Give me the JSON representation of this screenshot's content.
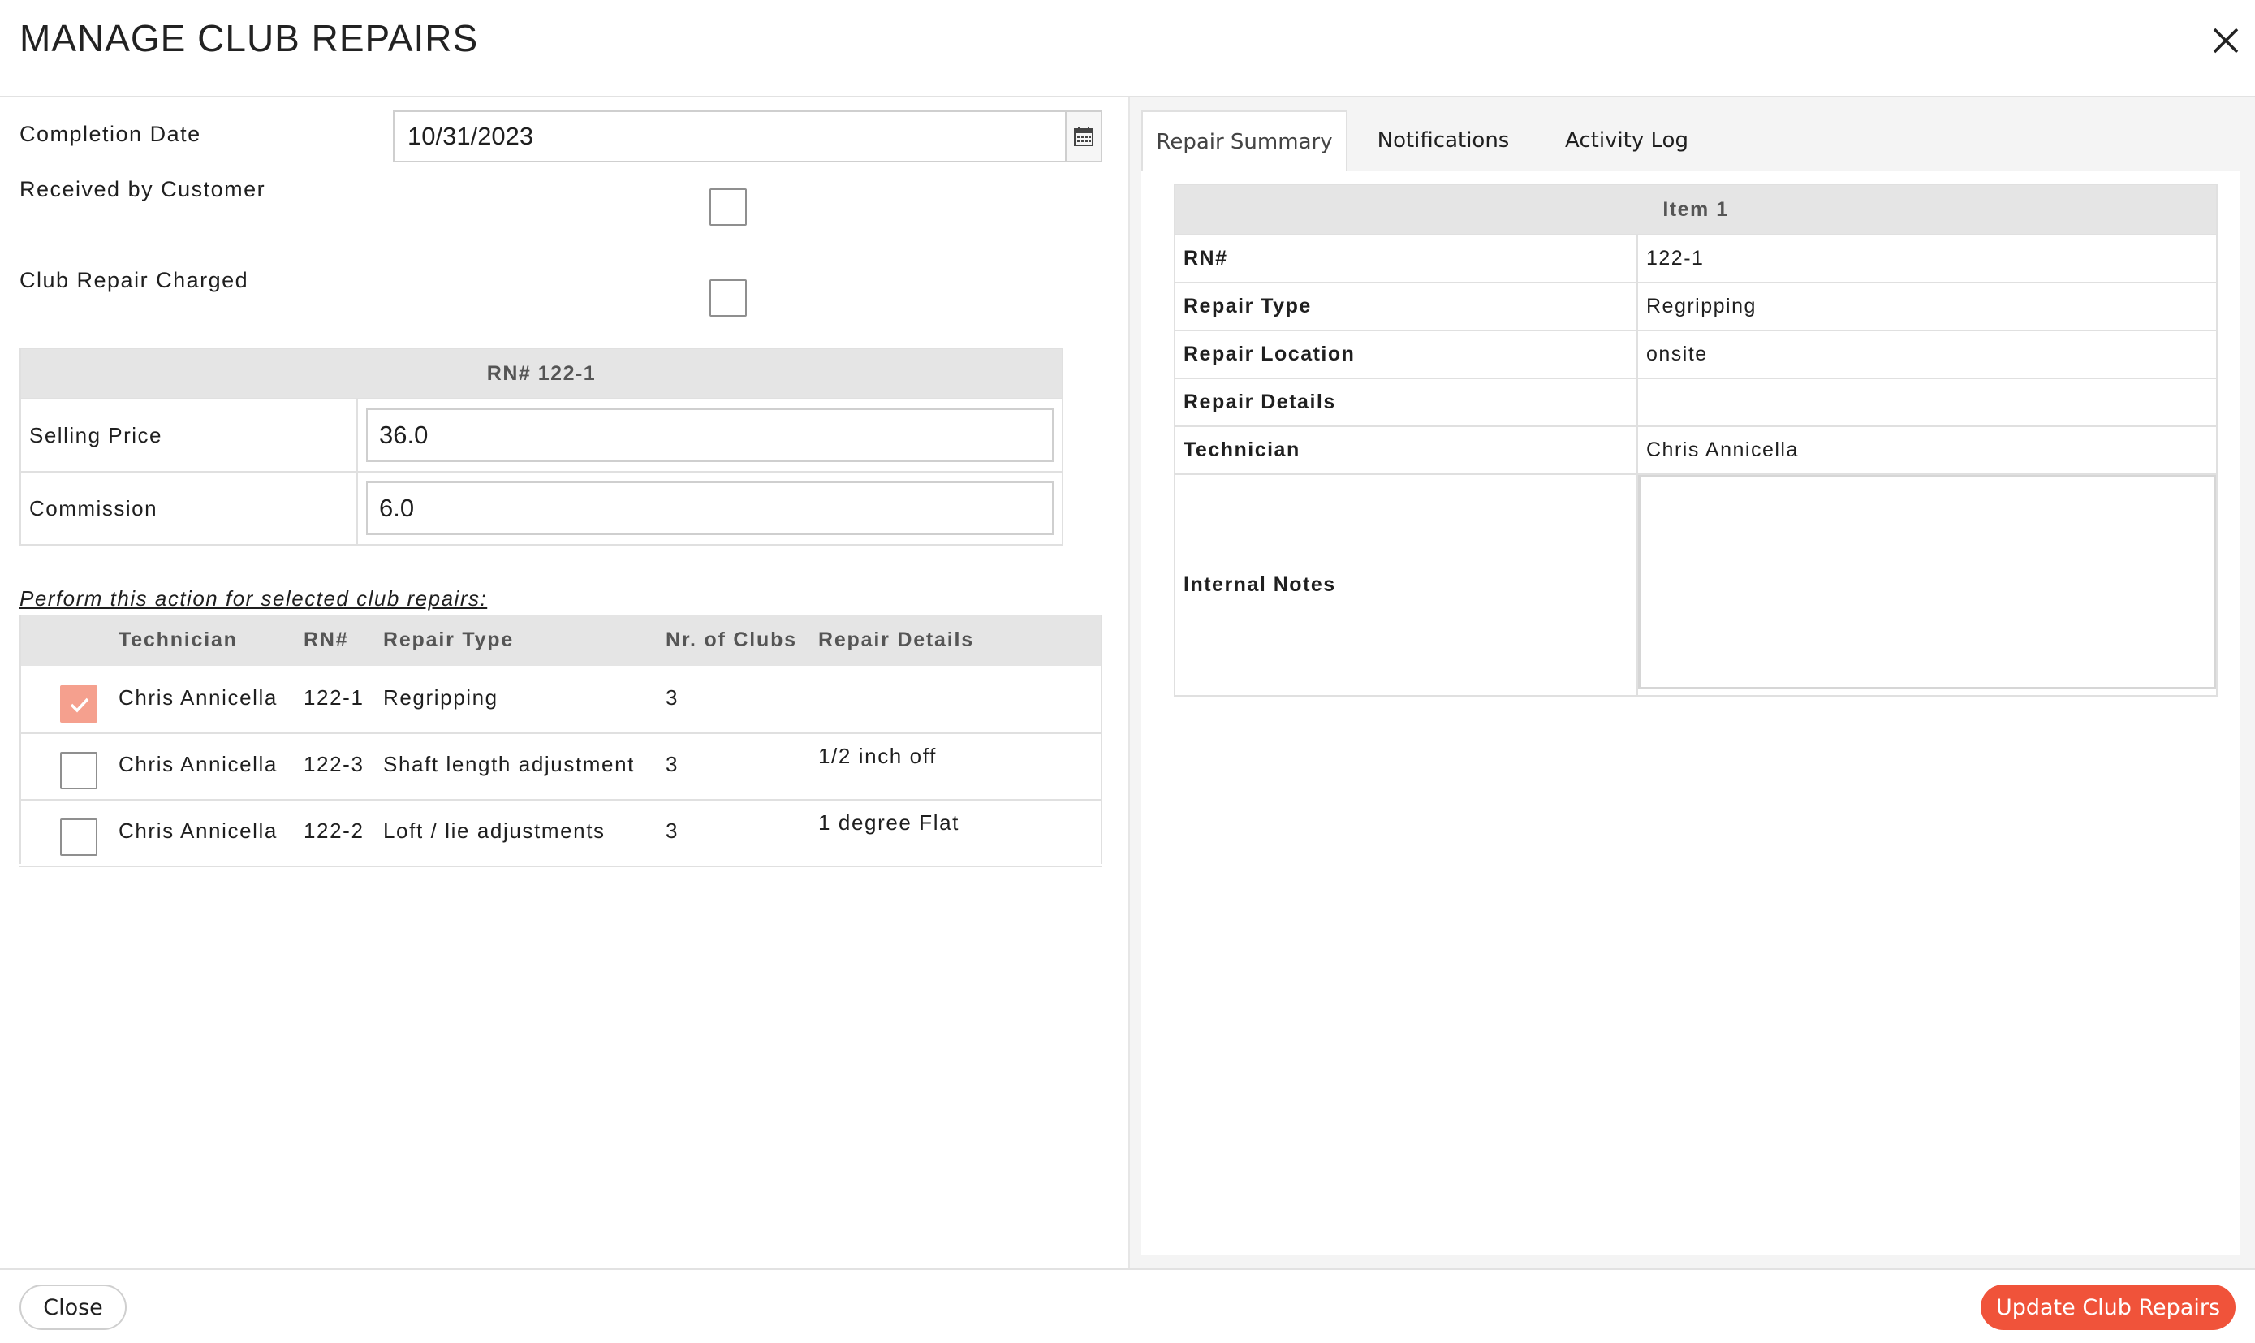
{
  "header": {
    "title": "MANAGE CLUB REPAIRS"
  },
  "form": {
    "completion_date_label": "Completion Date",
    "completion_date_value": "10/31/2023",
    "received_label": "Received by Customer",
    "charged_label": "Club Repair Charged"
  },
  "price_table": {
    "header": "RN# 122-1",
    "selling_price_label": "Selling Price",
    "selling_price_value": "36.0",
    "commission_label": "Commission",
    "commission_value": "6.0"
  },
  "repairs": {
    "perform_label": "Perform this action for selected club repairs:",
    "columns": [
      "Technician",
      "RN#",
      "Repair Type",
      "Nr. of Clubs",
      "Repair Details"
    ],
    "rows": [
      {
        "technician": "Chris Annicella",
        "rn": "122-1",
        "type": "Regripping",
        "clubs": "3",
        "details": "",
        "checked": true
      },
      {
        "technician": "Chris Annicella",
        "rn": "122-3",
        "type": "Shaft length adjustment",
        "clubs": "3",
        "details": "1/2 inch off",
        "checked": false
      },
      {
        "technician": "Chris Annicella",
        "rn": "122-2",
        "type": "Loft / lie adjustments",
        "clubs": "3",
        "details": "1 degree Flat",
        "checked": false
      }
    ]
  },
  "tabs": [
    "Repair Summary",
    "Notifications",
    "Activity Log"
  ],
  "summary": {
    "header": "Item 1",
    "rows": [
      {
        "label": "RN#",
        "value": "122-1"
      },
      {
        "label": "Repair Type",
        "value": "Regripping"
      },
      {
        "label": "Repair Location",
        "value": "onsite"
      },
      {
        "label": "Repair Details",
        "value": ""
      },
      {
        "label": "Technician",
        "value": "Chris Annicella"
      }
    ],
    "notes_label": "Internal Notes"
  },
  "footer": {
    "close_label": "Close",
    "update_label": "Update Club Repairs"
  },
  "colors": {
    "accent": "#f0533a",
    "checked": "#f5a08e"
  }
}
